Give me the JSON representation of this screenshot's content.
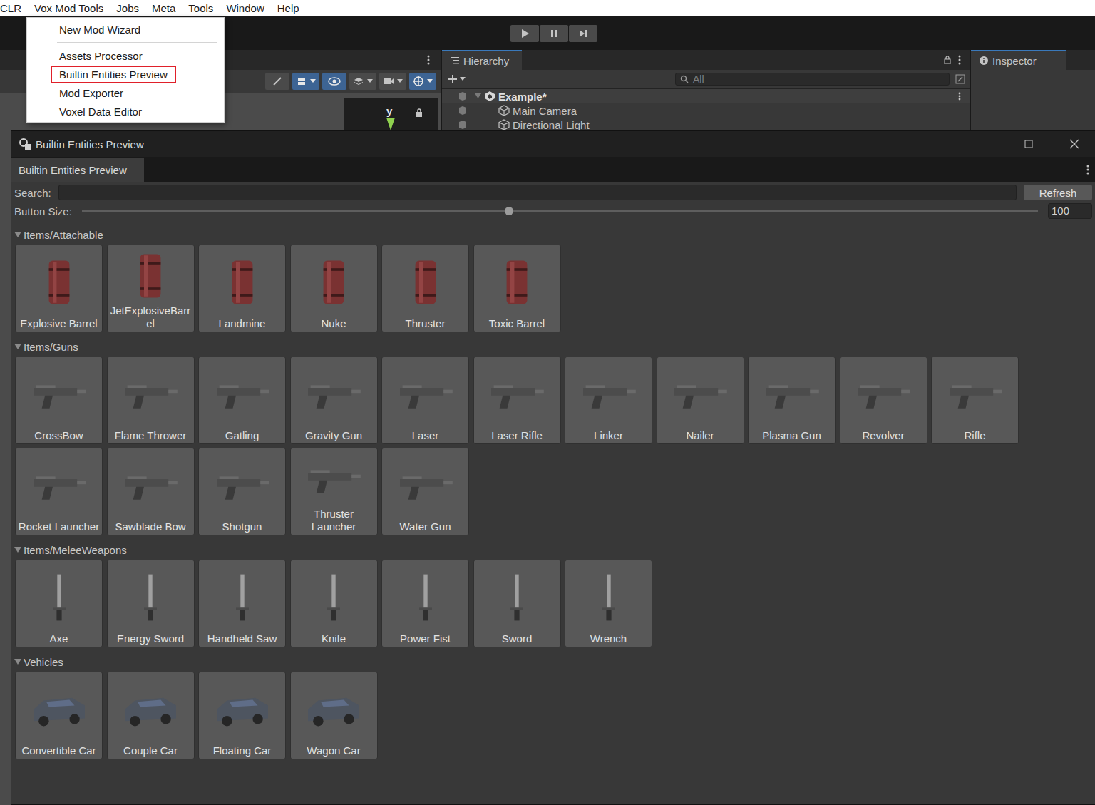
{
  "menubar": {
    "items": [
      {
        "label": "CLR",
        "open": false
      },
      {
        "label": "Vox Mod Tools",
        "open": true
      },
      {
        "label": "Jobs",
        "open": false
      },
      {
        "label": "Meta",
        "open": false
      },
      {
        "label": "Tools",
        "open": false
      },
      {
        "label": "Window",
        "open": false
      },
      {
        "label": "Help",
        "open": false
      }
    ]
  },
  "menu": {
    "groups": [
      {
        "items": [
          {
            "label": "New Mod Wizard",
            "selected": false
          }
        ]
      },
      {
        "items": [
          {
            "label": "Assets Processor",
            "selected": false
          },
          {
            "label": "Builtin Entities Preview",
            "selected": true
          },
          {
            "label": "Mod Exporter",
            "selected": false
          },
          {
            "label": "Voxel Data Editor",
            "selected": false
          }
        ]
      }
    ]
  },
  "scene": {
    "gizmo_label": "y"
  },
  "hierarchy": {
    "tab": "Hierarchy",
    "search_placeholder": "All",
    "scene": {
      "label": "Example*",
      "expanded": true
    },
    "objects": [
      "Main Camera",
      "Directional Light"
    ]
  },
  "inspector": {
    "tab": "Inspector"
  },
  "window": {
    "title": "Builtin Entities Preview",
    "tab": "Builtin Entities Preview"
  },
  "search": {
    "label": "Search:",
    "value": "",
    "button": "Refresh"
  },
  "button_size": {
    "label": "Button Size:",
    "level": 0.447,
    "reading": "100"
  },
  "groups": [
    {
      "title": "Items/Attachable",
      "kind": "attachable",
      "expanded": true,
      "items": [
        "Explosive Barrel",
        "JetExplosiveBarrel",
        "Landmine",
        "Nuke",
        "Thruster",
        "Toxic Barrel"
      ]
    },
    {
      "title": "Items/Guns",
      "kind": "gun",
      "expanded": true,
      "items": [
        "CrossBow",
        "Flame Thrower",
        "Gatling",
        "Gravity Gun",
        "Laser",
        "Laser Rifle",
        "Linker",
        "Nailer",
        "Plasma Gun",
        "Revolver",
        "Rifle",
        "Rocket Launcher",
        "Sawblade Bow",
        "Shotgun",
        "Thruster Launcher",
        "Water Gun"
      ]
    },
    {
      "title": "Items/MeleeWeapons",
      "kind": "melee",
      "expanded": true,
      "items": [
        "Axe",
        "Energy Sword",
        "Handheld Saw",
        "Knife",
        "Power Fist",
        "Sword",
        "Wrench"
      ]
    },
    {
      "title": "Vehicles",
      "kind": "vehicle",
      "expanded": true,
      "items": [
        "Convertible Car",
        "Couple Car",
        "Floating Car",
        "Wagon Car"
      ]
    }
  ]
}
